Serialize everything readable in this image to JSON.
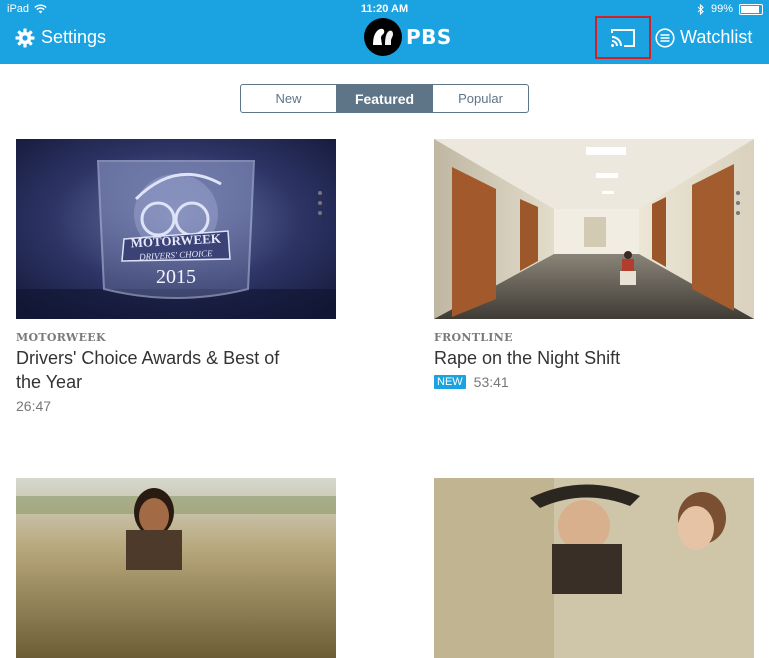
{
  "status_bar": {
    "device": "iPad",
    "time": "11:20 AM",
    "battery": "99%",
    "battery_level": 0.99
  },
  "header": {
    "settings_label": "Settings",
    "brand": "PBS",
    "watchlist_label": "Watchlist",
    "background": "#1aa3e0",
    "cast_highlight_color": "#d32027"
  },
  "tabs": [
    {
      "label": "New",
      "active": false
    },
    {
      "label": "Featured",
      "active": true
    },
    {
      "label": "Popular",
      "active": false
    }
  ],
  "videos": [
    {
      "show": "MOTORWEEK",
      "title": "Drivers' Choice Awards & Best of the Year",
      "duration": "26:47",
      "badge": ""
    },
    {
      "show": "FRONTLINE",
      "title": "Rape on the Night Shift",
      "duration": "53:41",
      "badge": "NEW"
    },
    {
      "show": "",
      "title": "",
      "duration": "",
      "badge": ""
    },
    {
      "show": "",
      "title": "",
      "duration": "",
      "badge": ""
    }
  ],
  "thumbnails": {
    "motorweek_text": [
      "MOTORWEEK",
      "DRIVERS' CHOICE",
      "2015"
    ]
  }
}
